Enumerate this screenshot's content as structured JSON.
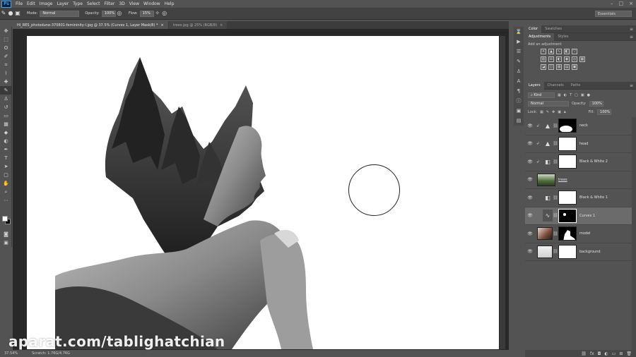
{
  "menubar": {
    "logo": "Ps",
    "items": [
      "File",
      "Edit",
      "Image",
      "Layer",
      "Type",
      "Select",
      "Filter",
      "3D",
      "View",
      "Window",
      "Help"
    ],
    "controls": [
      "–",
      "□",
      "×"
    ]
  },
  "options": {
    "mode_label": "Mode:",
    "mode_value": "Normal",
    "opacity_label": "Opacity:",
    "opacity_value": "100%",
    "flow_label": "Flow:",
    "flow_value": "15%",
    "workspace": "Essentials"
  },
  "tabs": [
    {
      "label": "HI_RES_photodune-370801-femininity-l.jpg @ 37.5% (Curves 1, Layer Mask/8) *",
      "active": true
    },
    {
      "label": "trees.jpg @ 25% (RGB/8)",
      "active": false
    }
  ],
  "status": {
    "zoom": "37.54%",
    "doc": "Scratch: 1.76G/4.76G"
  },
  "watermark": "aparat.com/tablighatchian",
  "panels": {
    "color_tabs": [
      "Color",
      "Swatches"
    ],
    "adjust_tabs": [
      "Adjustments",
      "Styles"
    ],
    "adjust_title": "Add an adjustment",
    "layers_tabs": [
      "Layers",
      "Channels",
      "Paths"
    ],
    "kind_label": "Kind",
    "blend_mode": "Normal",
    "opacity_label": "Opacity:",
    "opacity_value": "100%",
    "lock_label": "Lock:",
    "fill_label": "Fill:",
    "fill_value": "100%"
  },
  "layers": [
    {
      "name": "neck",
      "type": "adj-mask",
      "clipped": true,
      "selected": false
    },
    {
      "name": "head",
      "type": "adj-mask",
      "clipped": true,
      "selected": false
    },
    {
      "name": "Black & White 2",
      "type": "adj-mask",
      "clipped": true,
      "selected": false
    },
    {
      "name": "trees",
      "type": "image",
      "clipped": false,
      "selected": false
    },
    {
      "name": "Black & White 1",
      "type": "adj-mask",
      "clipped": false,
      "selected": false
    },
    {
      "name": "Curves 1",
      "type": "adj-mask",
      "clipped": false,
      "selected": true
    },
    {
      "name": "model",
      "type": "image-mask",
      "clipped": false,
      "selected": false
    },
    {
      "name": "background",
      "type": "image-mask",
      "clipped": false,
      "selected": false
    }
  ]
}
